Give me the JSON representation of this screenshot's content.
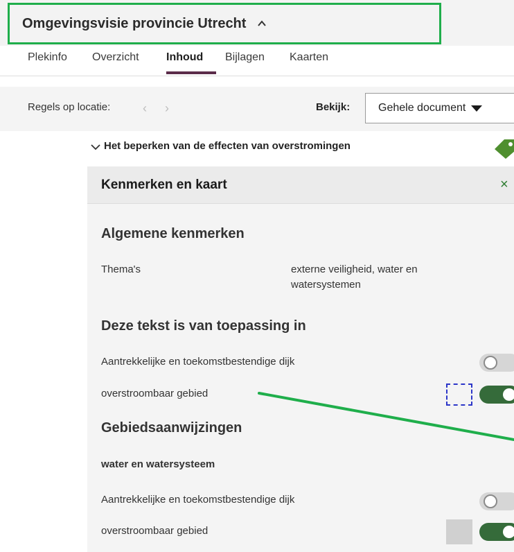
{
  "header": {
    "title": "Omgevingsvisie provincie Utrecht"
  },
  "tabs": [
    {
      "label": "Plekinfo"
    },
    {
      "label": "Overzicht"
    },
    {
      "label": "Inhoud"
    },
    {
      "label": "Bijlagen"
    },
    {
      "label": "Kaarten"
    }
  ],
  "locbar": {
    "label": "Regels op locatie:",
    "view_label": "Bekijk:",
    "view_value": "Gehele document"
  },
  "section": {
    "title": "Het beperken van de effecten van overstromingen"
  },
  "panel": {
    "title": "Kenmerken en kaart",
    "close": "×",
    "general": {
      "heading": "Algemene kenmerken",
      "themes_label": "Thema's",
      "themes_value": "externe veiligheid, water en watersystemen"
    },
    "applicable": {
      "heading": "Deze tekst is van toepassing in",
      "items": [
        {
          "label": "Aantrekkelijke en toekomstbestendige dijk",
          "on": false
        },
        {
          "label": "overstroombaar gebied",
          "on": true
        }
      ]
    },
    "designations": {
      "heading": "Gebiedsaanwijzingen",
      "group": "water en watersysteem",
      "items": [
        {
          "label": "Aantrekkelijke en toekomstbestendige dijk",
          "on": false
        },
        {
          "label": "overstroombaar gebied",
          "on": true
        }
      ]
    }
  },
  "colors": {
    "highlight": "#1fae4b",
    "toggle_on": "#356b3a",
    "tab_underline": "#5b2c4a"
  }
}
